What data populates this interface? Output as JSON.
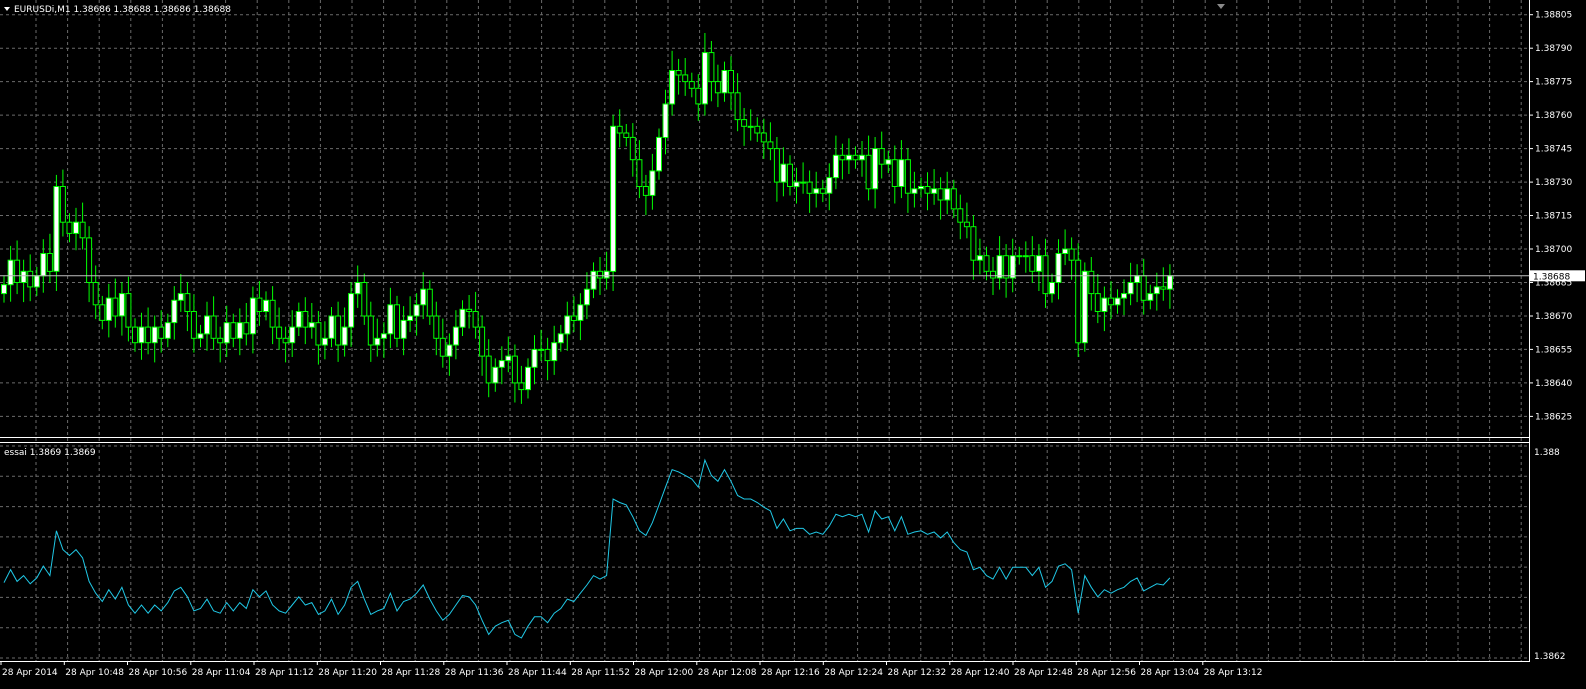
{
  "header": {
    "main_title": "EURUSDi,M1  1.38686 1.38688 1.38686 1.38688",
    "indicator_title": "essai 1.3869 1.3869"
  },
  "colors": {
    "background": "#000000",
    "grid": "#6b6b6b",
    "candle": "#00ff00",
    "bull_body": "#ffffff",
    "bear_body": "#000000",
    "indicator_line": "#20c8e6",
    "bid_line": "#c0c0c0",
    "axis": "#ffffff"
  },
  "price_axis": {
    "ticks": [
      "1.38805",
      "1.38790",
      "1.38775",
      "1.38760",
      "1.38745",
      "1.38730",
      "1.38715",
      "1.38700",
      "1.38685",
      "1.38670",
      "1.38655",
      "1.38640",
      "1.38625"
    ],
    "current_price_label": "1.38688"
  },
  "indicator_axis": {
    "top_label": "1.388",
    "bottom_label": "1.3862"
  },
  "time_axis": {
    "labels": [
      "28 Apr 2014",
      "28 Apr 10:48",
      "28 Apr 10:56",
      "28 Apr 11:04",
      "28 Apr 11:12",
      "28 Apr 11:20",
      "28 Apr 11:28",
      "28 Apr 11:36",
      "28 Apr 11:44",
      "28 Apr 11:52",
      "28 Apr 12:00",
      "28 Apr 12:08",
      "28 Apr 12:16",
      "28 Apr 12:24",
      "28 Apr 12:32",
      "28 Apr 12:40",
      "28 Apr 12:48",
      "28 Apr 12:56",
      "28 Apr 13:04",
      "28 Apr 13:12"
    ]
  },
  "chart_data": [
    {
      "type": "candlestick",
      "symbol": "EURUSDi",
      "timeframe": "M1",
      "ylim": [
        1.38618,
        1.38808
      ],
      "grid": true,
      "current_price": 1.38688,
      "closes": [
        1.38684,
        1.38695,
        1.38685,
        1.3869,
        1.38683,
        1.38688,
        1.38698,
        1.3869,
        1.38728,
        1.38712,
        1.38707,
        1.38712,
        1.38705,
        1.38685,
        1.38675,
        1.38668,
        1.38678,
        1.3867,
        1.3868,
        1.38665,
        1.38658,
        1.38665,
        1.38658,
        1.38665,
        1.3866,
        1.38667,
        1.38677,
        1.3868,
        1.38672,
        1.3866,
        1.38662,
        1.3867,
        1.3866,
        1.38658,
        1.38667,
        1.3866,
        1.38667,
        1.38662,
        1.38678,
        1.38672,
        1.38677,
        1.38665,
        1.3866,
        1.38658,
        1.38665,
        1.38672,
        1.38665,
        1.38667,
        1.38657,
        1.3866,
        1.3867,
        1.38657,
        1.38665,
        1.3868,
        1.38685,
        1.3867,
        1.38657,
        1.3866,
        1.38662,
        1.38675,
        1.3866,
        1.38668,
        1.3867,
        1.38675,
        1.38682,
        1.3867,
        1.3866,
        1.38652,
        1.38657,
        1.38665,
        1.38673,
        1.38672,
        1.38665,
        1.38652,
        1.3864,
        1.38647,
        1.3865,
        1.38652,
        1.3864,
        1.38637,
        1.38647,
        1.38655,
        1.38655,
        1.3865,
        1.38658,
        1.38662,
        1.3867,
        1.38668,
        1.38675,
        1.38682,
        1.3869,
        1.38687,
        1.3869,
        1.38755,
        1.38752,
        1.3875,
        1.3874,
        1.38728,
        1.38724,
        1.38735,
        1.3875,
        1.38765,
        1.3878,
        1.38778,
        1.38775,
        1.38772,
        1.38765,
        1.38788,
        1.38775,
        1.3877,
        1.3878,
        1.3877,
        1.38758,
        1.38755,
        1.38755,
        1.38752,
        1.38748,
        1.38745,
        1.3873,
        1.38738,
        1.38728,
        1.3873,
        1.3873,
        1.38725,
        1.38727,
        1.38725,
        1.38732,
        1.38742,
        1.3874,
        1.38742,
        1.3874,
        1.38742,
        1.38727,
        1.38745,
        1.38738,
        1.3874,
        1.38728,
        1.3874,
        1.38725,
        1.38727,
        1.38728,
        1.38725,
        1.38727,
        1.38722,
        1.38727,
        1.38718,
        1.38712,
        1.3871,
        1.38695,
        1.38697,
        1.3869,
        1.38687,
        1.38697,
        1.38687,
        1.38697,
        1.38697,
        1.38697,
        1.3869,
        1.38697,
        1.3868,
        1.38685,
        1.38698,
        1.387,
        1.38695,
        1.38658,
        1.3869,
        1.3868,
        1.38672,
        1.38678,
        1.38675,
        1.38678,
        1.3868,
        1.38685,
        1.38688,
        1.38677,
        1.3868,
        1.38683,
        1.38682,
        1.38688
      ]
    },
    {
      "type": "line",
      "name": "essai",
      "ylim": [
        1.3862,
        1.388
      ],
      "source": "closes"
    }
  ]
}
